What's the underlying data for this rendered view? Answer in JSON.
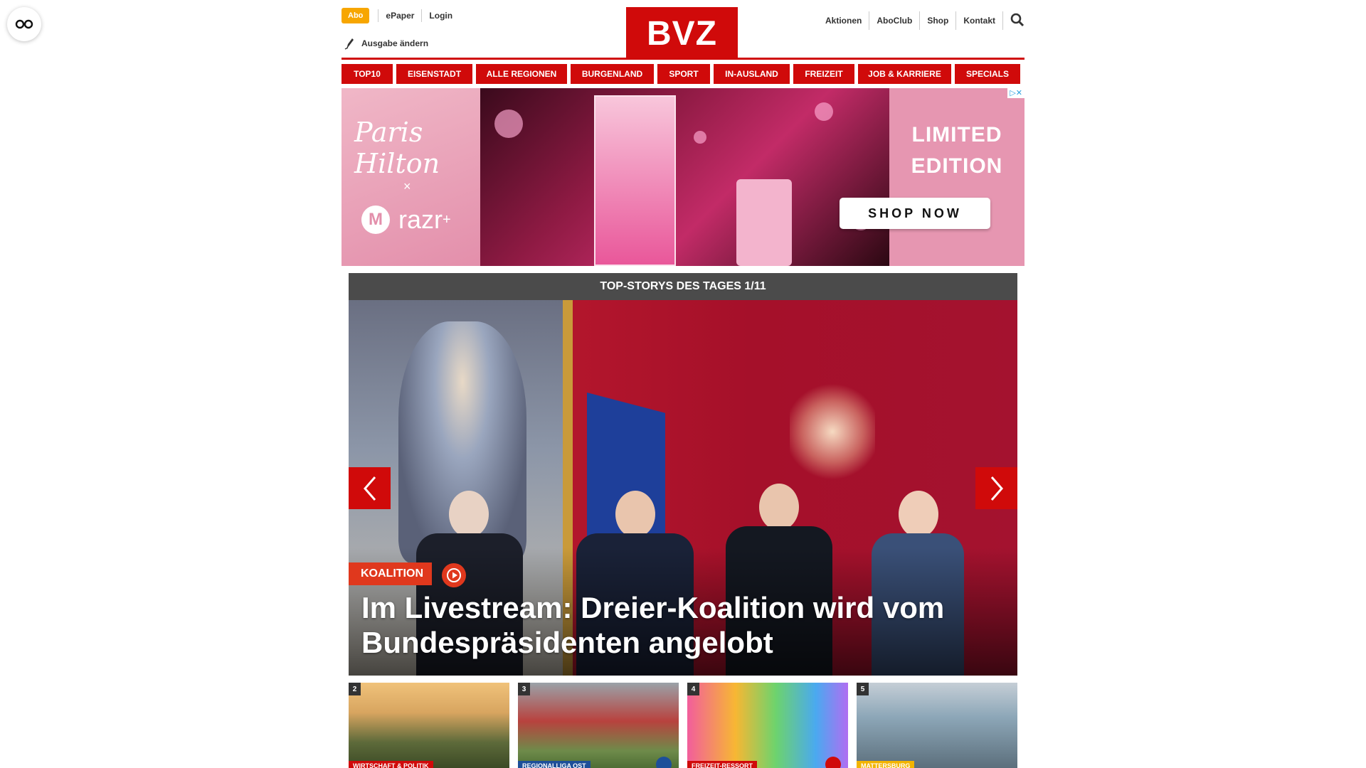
{
  "reader_icon": "glasses-icon",
  "header": {
    "abo": "Abo",
    "links_left": [
      "ePaper",
      "Login"
    ],
    "edition": "Ausgabe ändern",
    "logo": "BVZ",
    "links_right": [
      "Aktionen",
      "AboClub",
      "Shop",
      "Kontakt"
    ],
    "search_icon": "search-icon"
  },
  "nav": [
    "TOP10",
    "EISENSTADT",
    "ALLE REGIONEN",
    "BURGENLAND",
    "SPORT",
    "IN-AUSLAND",
    "FREIZEIT",
    "JOB & KARRIERE",
    "SPECIALS"
  ],
  "ad": {
    "signature": "Paris Hilton",
    "times": "×",
    "brand": "razr",
    "brand_sup": "+",
    "limited_line1": "LIMITED",
    "limited_line2": "EDITION",
    "cta": "SHOP NOW",
    "choices": "▷✕"
  },
  "stories": {
    "heading": "TOP-STORYS DES TAGES 1/11",
    "hero_tag": "KOALITION",
    "hero_title": "Im Livestream: Dreier-Koalition wird vom Bundespräsidenten angelobt",
    "thumbs": [
      {
        "num": "2",
        "category": "WIRTSCHAFT & POLITIK",
        "color": "#d00a0a"
      },
      {
        "num": "3",
        "category": "REGIONALLIGA OST",
        "color": "#1d4f99"
      },
      {
        "num": "4",
        "category": "FREIZEIT-RESSORT",
        "color": "#d00a0a"
      },
      {
        "num": "5",
        "category": "MATTERSBURG",
        "color": "#f3b400"
      }
    ]
  },
  "colors": {
    "brand_red": "#d00a0a",
    "abo_orange": "#f7a600",
    "tag_orange": "#e0381d"
  }
}
